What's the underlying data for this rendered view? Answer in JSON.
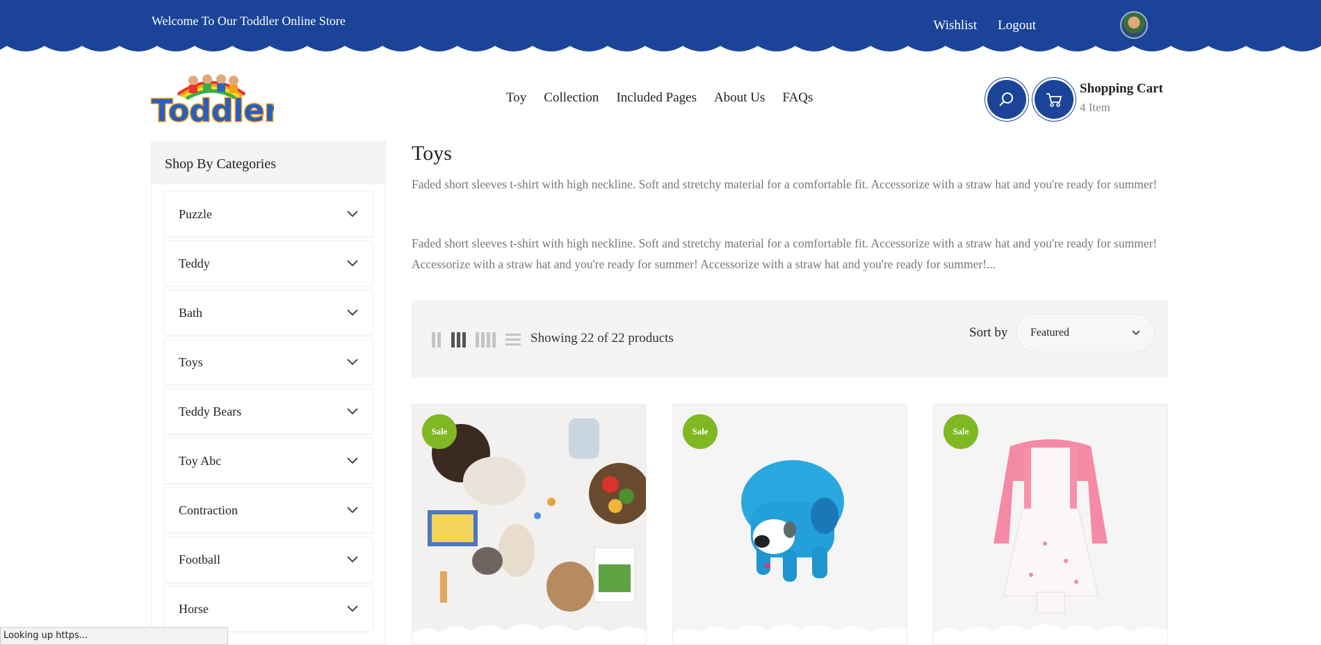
{
  "topbar": {
    "welcome": "Welcome To Our Toddler Online Store",
    "wishlist": "Wishlist",
    "logout": "Logout",
    "bg_color": "#1b4499"
  },
  "header": {
    "logo_text": "Toddler",
    "nav": [
      "Toy",
      "Collection",
      "Included Pages",
      "About Us",
      "FAQs"
    ],
    "cart_title": "Shopping Cart",
    "cart_count": "4 Item"
  },
  "sidebar": {
    "title": "Shop By Categories",
    "categories": [
      "Puzzle",
      "Teddy",
      "Bath",
      "Toys",
      "Teddy Bears",
      "Toy Abc",
      "Contraction",
      "Football",
      "Horse"
    ]
  },
  "content": {
    "title": "Toys",
    "desc1": "Faded short sleeves t-shirt with high neckline. Soft and stretchy material for a comfortable fit. Accessorize with a straw hat and you're ready for summer!",
    "desc2": "Faded short sleeves t-shirt with high neckline. Soft and stretchy material for a comfortable fit. Accessorize with a straw hat and you're ready for summer! Accessorize with a straw hat and you're ready for summer! Accessorize with a straw hat and you're ready for summer!..."
  },
  "toolbar": {
    "showing": "Showing 22 of 22 products",
    "sort_label": "Sort by",
    "sort_value": "Featured"
  },
  "products": [
    {
      "badge": "Sale"
    },
    {
      "badge": "Sale"
    },
    {
      "badge": "Sale"
    }
  ],
  "status": {
    "text": "Looking up https..."
  },
  "colors": {
    "brand_blue": "#1b4499",
    "sale_green": "#80b823"
  }
}
